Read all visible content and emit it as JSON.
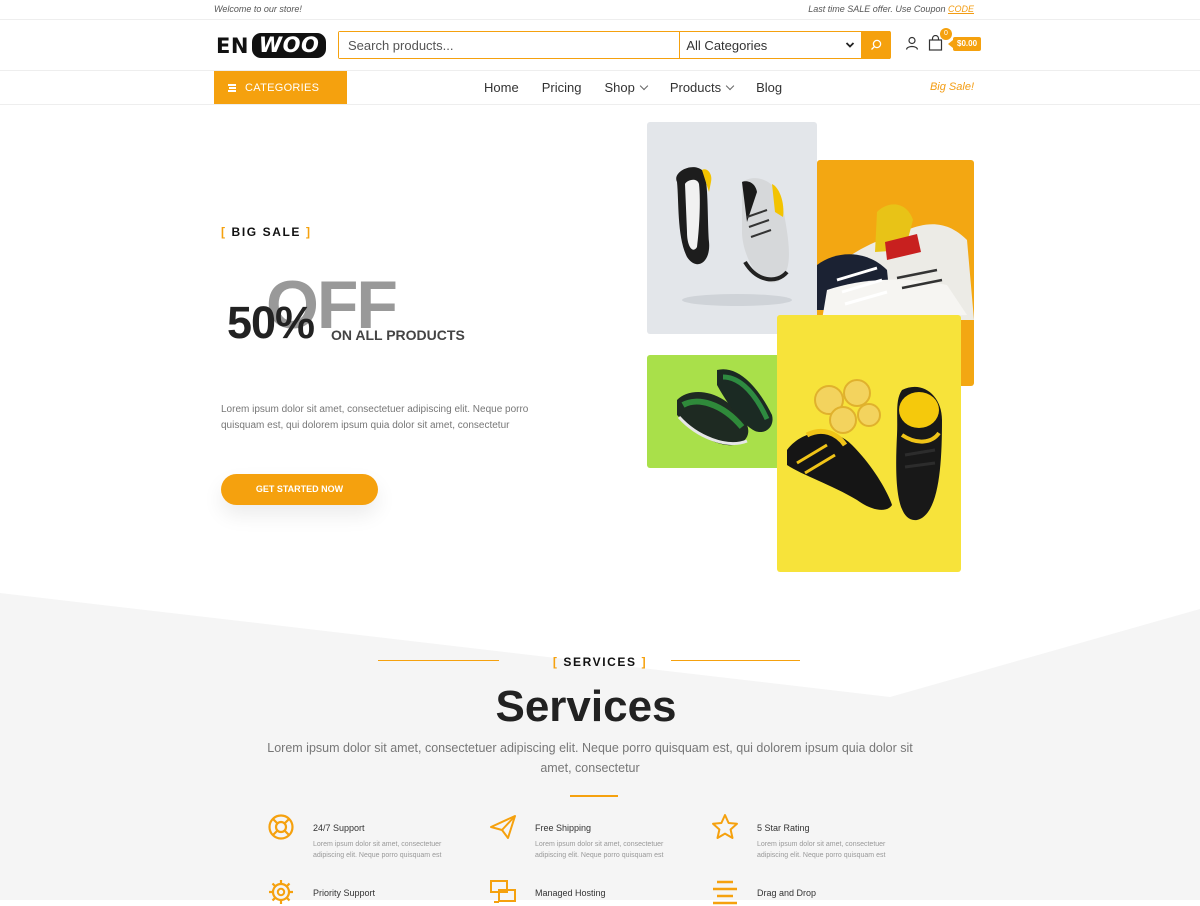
{
  "topbar": {
    "welcome": "Welcome to our store!",
    "offer_text": "Last time SALE offer. Use Coupon",
    "coupon": "CODE"
  },
  "header": {
    "logo_left": "EN",
    "logo_right": "WOO",
    "search_placeholder": "Search products...",
    "category_selected": "All Categories",
    "cart_count": "0",
    "cart_total": "$0.00"
  },
  "navbar": {
    "categories_label": "CATEGORIES",
    "items": [
      {
        "label": "Home",
        "dropdown": false
      },
      {
        "label": "Pricing",
        "dropdown": false
      },
      {
        "label": "Shop",
        "dropdown": true
      },
      {
        "label": "Products",
        "dropdown": true
      },
      {
        "label": "Blog",
        "dropdown": false
      }
    ],
    "right_link": "Big Sale!"
  },
  "hero": {
    "tag_open": "[",
    "tag": "BIG SALE",
    "tag_close": "]",
    "off_bg": "OFF",
    "percent": "50%",
    "on_all": "ON ALL PRODUCTS",
    "description": "Lorem ipsum dolor sit amet, consectetuer adipiscing elit. Neque porro quisquam est, qui dolorem ipsum quia dolor sit amet, consectetur",
    "cta": "GET STARTED NOW"
  },
  "services": {
    "tag_open": "[",
    "tag": "SERVICES",
    "tag_close": "]",
    "title": "Services",
    "description": "Lorem ipsum dolor sit amet, consectetuer adipiscing elit. Neque porro quisquam est, qui dolorem ipsum quia dolor sit amet, consectetur",
    "features": [
      {
        "title": "24/7 Support",
        "icon": "lifebuoy-icon",
        "desc": "Lorem ipsum dolor sit amet, consectetuer adipiscing elit. Neque porro quisquam est"
      },
      {
        "title": "Free Shipping",
        "icon": "paper-plane-icon",
        "desc": "Lorem ipsum dolor sit amet, consectetuer adipiscing elit. Neque porro quisquam est"
      },
      {
        "title": "5 Star Rating",
        "icon": "star-icon",
        "desc": "Lorem ipsum dolor sit amet, consectetuer adipiscing elit. Neque porro quisquam est"
      },
      {
        "title": "Priority Support",
        "icon": "gear-icon",
        "desc": ""
      },
      {
        "title": "Managed Hosting",
        "icon": "server-icon",
        "desc": ""
      },
      {
        "title": "Drag and Drop",
        "icon": "align-icon",
        "desc": ""
      }
    ]
  },
  "colors": {
    "accent": "#f5a10e",
    "dark": "#222222",
    "services_bg": "#f5f5f5"
  }
}
